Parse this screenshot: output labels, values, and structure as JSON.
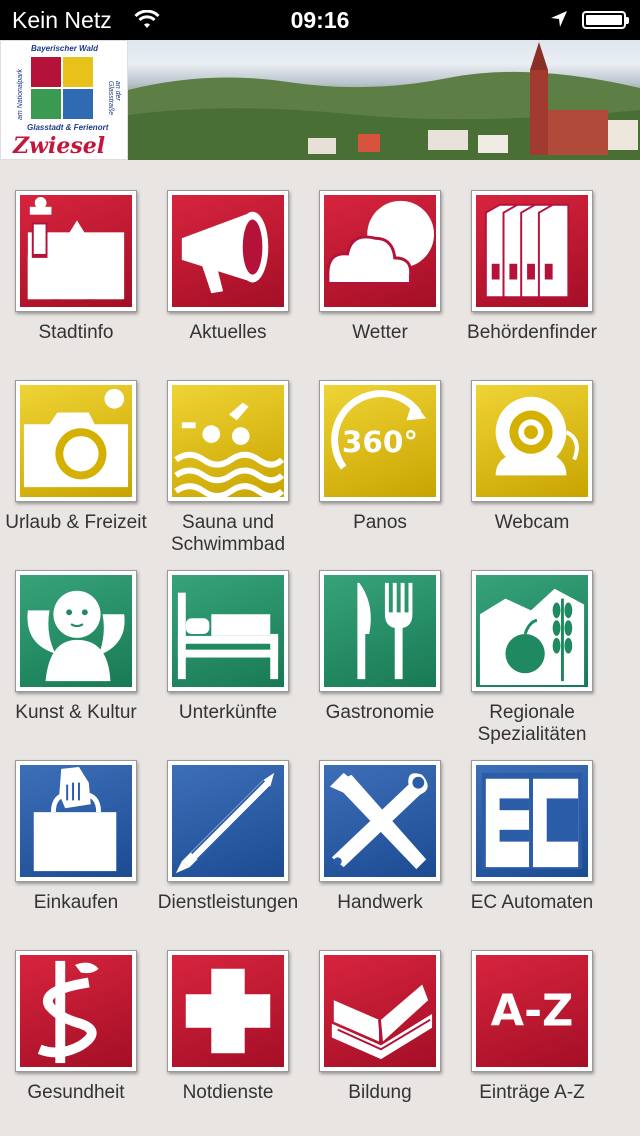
{
  "status_bar": {
    "carrier": "Kein Netz",
    "time": "09:16",
    "battery_level": 0.9
  },
  "header": {
    "logo": {
      "top_text": "Bayerischer Wald",
      "left_text": "am Nationalpark",
      "right_text": "an der Glasstraße",
      "subtitle": "Glasstadt & Ferienort",
      "brand": "Zwiesel"
    }
  },
  "colors": {
    "red": "#b5123a",
    "yellow": "#e0c010",
    "green": "#1f8a60",
    "blue": "#2a5ca8"
  },
  "tiles": [
    {
      "label": "Stadtinfo",
      "icon": "info-town-icon",
      "color": "red"
    },
    {
      "label": "Aktuelles",
      "icon": "megaphone-icon",
      "color": "red"
    },
    {
      "label": "Wetter",
      "icon": "cloud-icon",
      "color": "red"
    },
    {
      "label": "Behördenfinder",
      "icon": "binders-icon",
      "color": "red"
    },
    {
      "label": "Urlaub & Freizeit",
      "icon": "camera-icon",
      "color": "yellow"
    },
    {
      "label": "Sauna und Schwimmbad",
      "icon": "swimmer-icon",
      "color": "yellow"
    },
    {
      "label": "Panos",
      "icon": "panorama-360-icon",
      "color": "yellow"
    },
    {
      "label": "Webcam",
      "icon": "webcam-icon",
      "color": "yellow"
    },
    {
      "label": "Kunst & Kultur",
      "icon": "angel-icon",
      "color": "green"
    },
    {
      "label": "Unterkünfte",
      "icon": "bed-icon",
      "color": "green"
    },
    {
      "label": "Gastronomie",
      "icon": "cutlery-icon",
      "color": "green"
    },
    {
      "label": "Regionale Spezialitäten",
      "icon": "apple-wheat-icon",
      "color": "green"
    },
    {
      "label": "Einkaufen",
      "icon": "shopping-bag-icon",
      "color": "blue"
    },
    {
      "label": "Dienstleistungen",
      "icon": "pencil-icon",
      "color": "blue"
    },
    {
      "label": "Handwerk",
      "icon": "hammer-wrench-icon",
      "color": "blue"
    },
    {
      "label": "EC Automaten",
      "icon": "ec-icon",
      "color": "blue"
    },
    {
      "label": "Gesundheit",
      "icon": "caduceus-icon",
      "color": "red"
    },
    {
      "label": "Notdienste",
      "icon": "cross-icon",
      "color": "red"
    },
    {
      "label": "Bildung",
      "icon": "book-icon",
      "color": "red"
    },
    {
      "label": "Einträge A-Z",
      "icon": "a-z-icon",
      "color": "red"
    }
  ],
  "icon_texts": {
    "panorama": "360°",
    "ec": "ec",
    "az": "A-Z"
  }
}
